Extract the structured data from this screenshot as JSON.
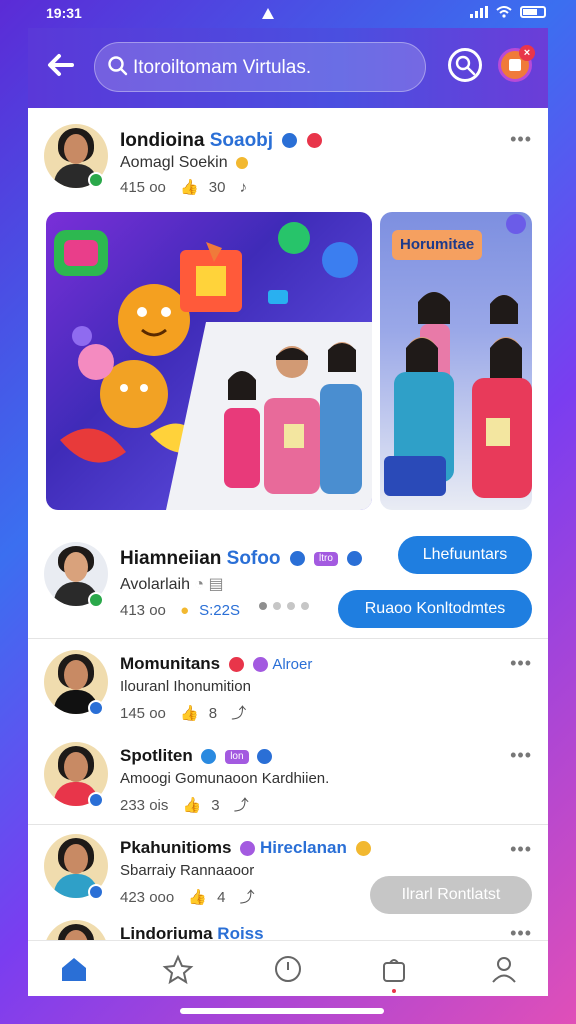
{
  "status": {
    "time": "19:31"
  },
  "search": {
    "text": "Itoroiltomam Virtulas."
  },
  "featured": {
    "name_main": "Iondioina",
    "name_highlight": "Soaobj",
    "subtitle": "Aomagl Soekin",
    "meta_a": "415 oo",
    "meta_b": "30",
    "gallery_side_label": "Horumitae",
    "dots": 4
  },
  "post2": {
    "name_main": "Hiamneiian",
    "name_highlight": "Sofoo",
    "pill": "ltro",
    "subtitle": "Avolarlaih",
    "meta_a": "413 oo",
    "meta_b": "S:22S",
    "follow_label": "Lhefuuntars",
    "join_label": "Ruaoo Konltodmtes"
  },
  "posts": [
    {
      "name_main": "Momunitans",
      "name_highlight": "Alroer",
      "subtitle": "Ilouranl Ihonumition",
      "meta_a": "145 oo",
      "meta_b": "8"
    },
    {
      "name_main": "Spotliten",
      "name_highlight": "",
      "pill": "lon",
      "subtitle": "Amoogi Gomunaoon Kardhiien.",
      "meta_a": "233 ois",
      "meta_b": "3"
    },
    {
      "name_main": "Pkahunitioms",
      "name_highlight": "Hireclanan",
      "subtitle": "Sbarraiy Rannaaoor",
      "meta_a": "423 ooo",
      "meta_b": "4",
      "action_label": "Ilrarl Rontlatst"
    },
    {
      "name_main": "Lindoriuma",
      "name_highlight": "Roiss",
      "subtitle": "",
      "meta_a": "",
      "meta_b": ""
    }
  ],
  "nav": [
    "home-icon",
    "star-icon",
    "compass-icon",
    "bag-icon",
    "profile-icon"
  ],
  "colors": {
    "accent": "#1f7ee0",
    "topbar": "#5a38d8",
    "badge": "#e8354a"
  }
}
